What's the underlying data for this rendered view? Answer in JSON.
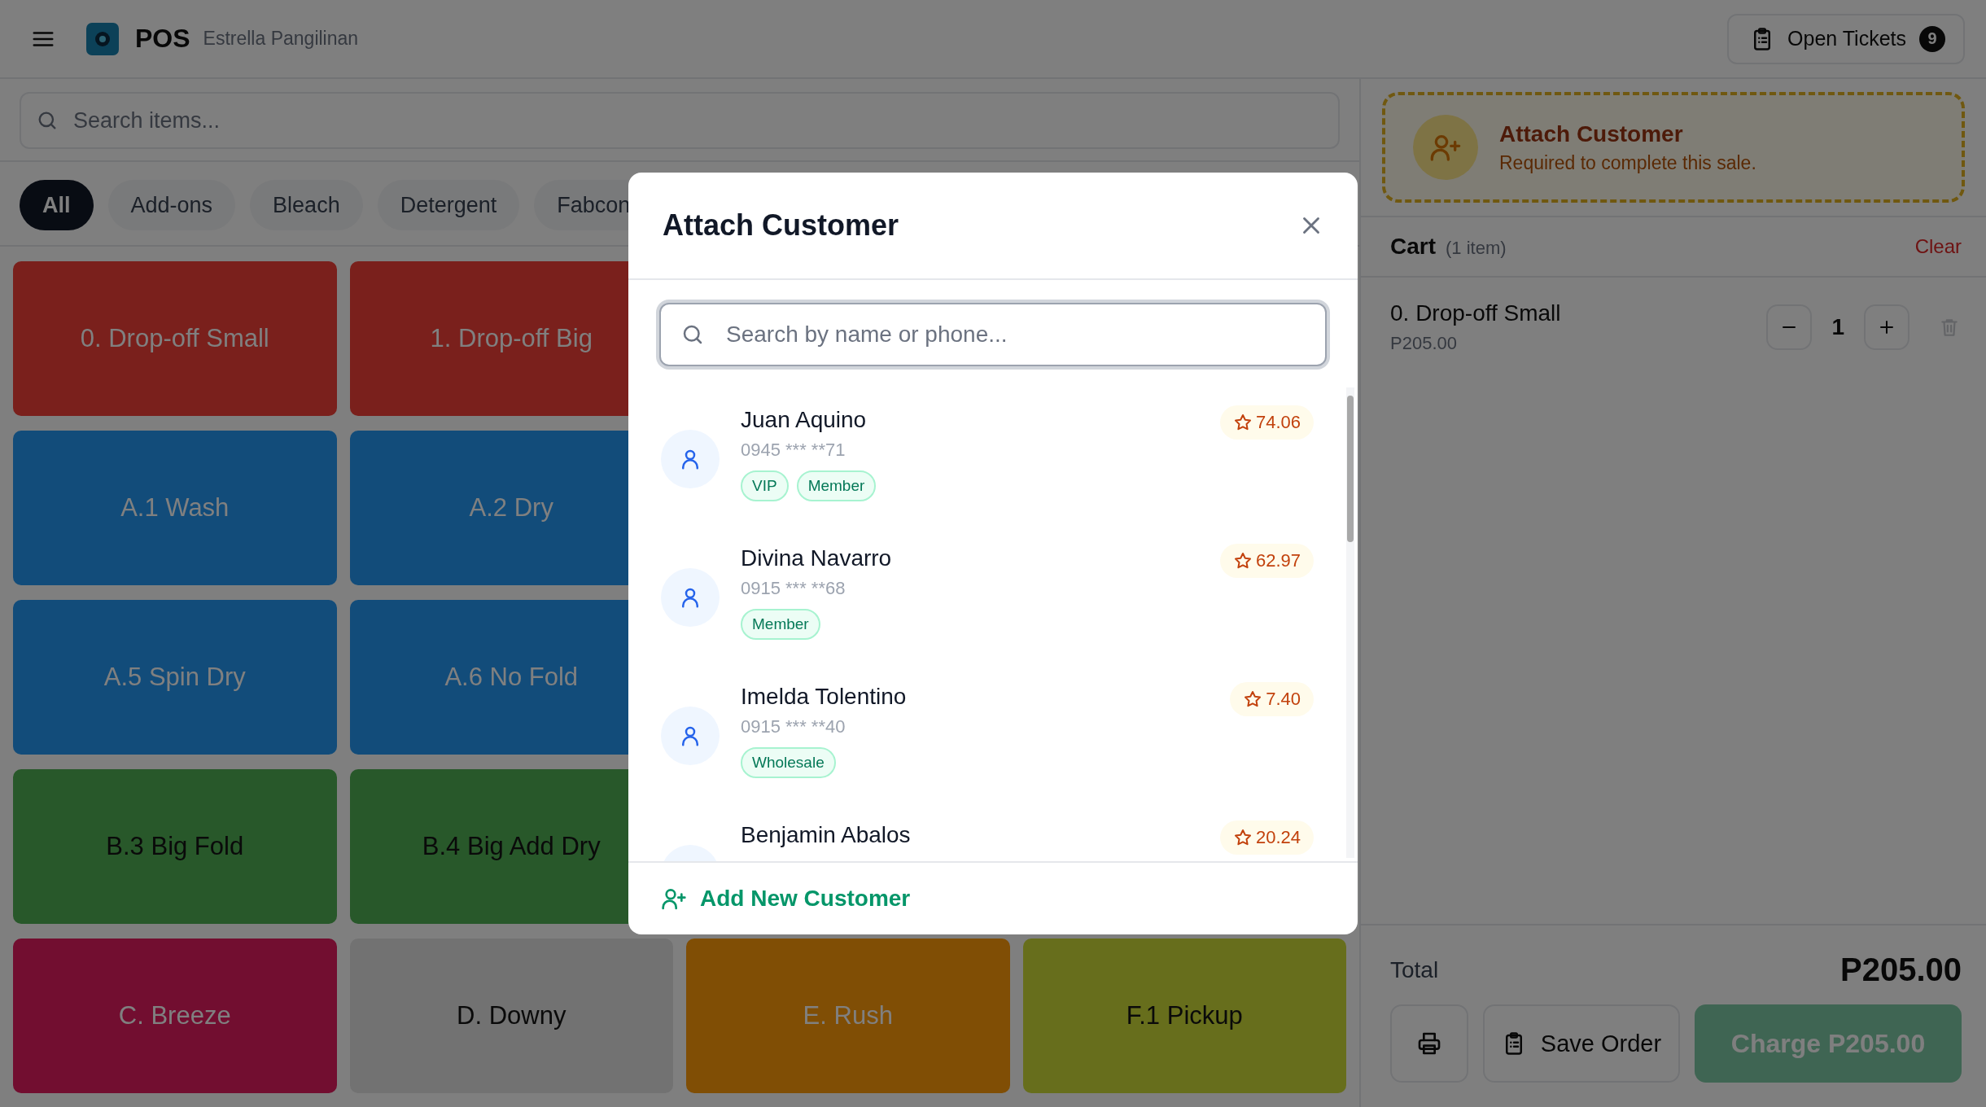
{
  "header": {
    "app_name": "POS",
    "user_name": "Estrella Pangilinan",
    "open_tickets": {
      "label": "Open Tickets",
      "count": "9"
    }
  },
  "search": {
    "placeholder": "Search items..."
  },
  "categories": [
    {
      "label": "All",
      "selected": true
    },
    {
      "label": "Add-ons",
      "selected": false
    },
    {
      "label": "Bleach",
      "selected": false
    },
    {
      "label": "Detergent",
      "selected": false
    },
    {
      "label": "Fabcon",
      "selected": false
    }
  ],
  "tile_rows": [
    [
      {
        "label": "0. Drop-off Small",
        "color": "#7a201c",
        "dark_label": false
      },
      {
        "label": "1. Drop-off Big",
        "color": "#7a201c",
        "dark_label": false
      }
    ],
    [
      {
        "label": "A.1 Wash",
        "color": "#124c7a",
        "dark_label": false
      },
      {
        "label": "A.2 Dry",
        "color": "#124c7a",
        "dark_label": false
      }
    ],
    [
      {
        "label": "A.5 Spin Dry",
        "color": "#124c7a",
        "dark_label": false
      },
      {
        "label": "A.6 No Fold",
        "color": "#124c7a",
        "dark_label": false
      }
    ],
    [
      {
        "label": "B.3 Big Fold",
        "color": "#28582a",
        "dark_label": true
      },
      {
        "label": "B.4 Big Add Dry",
        "color": "#28582a",
        "dark_label": true
      }
    ],
    [
      {
        "label": "C. Breeze",
        "color": "#720e30",
        "dark_label": false
      },
      {
        "label": "D. Downy",
        "color": "#727272",
        "dark_label": true
      },
      {
        "label": "E. Rush",
        "color": "#804e05",
        "dark_label": false
      },
      {
        "label": "F.1 Pickup",
        "color": "#676e1c",
        "dark_label": true
      }
    ]
  ],
  "customer_prompt": {
    "title": "Attach Customer",
    "subtitle": "Required to complete this sale."
  },
  "cart": {
    "title": "Cart",
    "count": "(1 item)",
    "clear": "Clear",
    "items": [
      {
        "name": "0. Drop-off Small",
        "price": "P205.00",
        "quantity": "1"
      }
    ],
    "total_label": "Total",
    "total": "P205.00",
    "save_label": "Save Order",
    "charge_label": "Charge P205.00"
  },
  "modal": {
    "title": "Attach Customer",
    "search_placeholder": "Search by name or phone...",
    "customers": [
      {
        "name": "Juan Aquino",
        "phone": "0945 *** **71",
        "points": "74.06",
        "tags": [
          "VIP",
          "Member"
        ]
      },
      {
        "name": "Divina Navarro",
        "phone": "0915 *** **68",
        "points": "62.97",
        "tags": [
          "Member"
        ]
      },
      {
        "name": "Imelda Tolentino",
        "phone": "0915 *** **40",
        "points": "7.40",
        "tags": [
          "Wholesale"
        ]
      },
      {
        "name": "Benjamin Abalos",
        "points": "20.24"
      }
    ],
    "add_label": "Add New Customer"
  }
}
